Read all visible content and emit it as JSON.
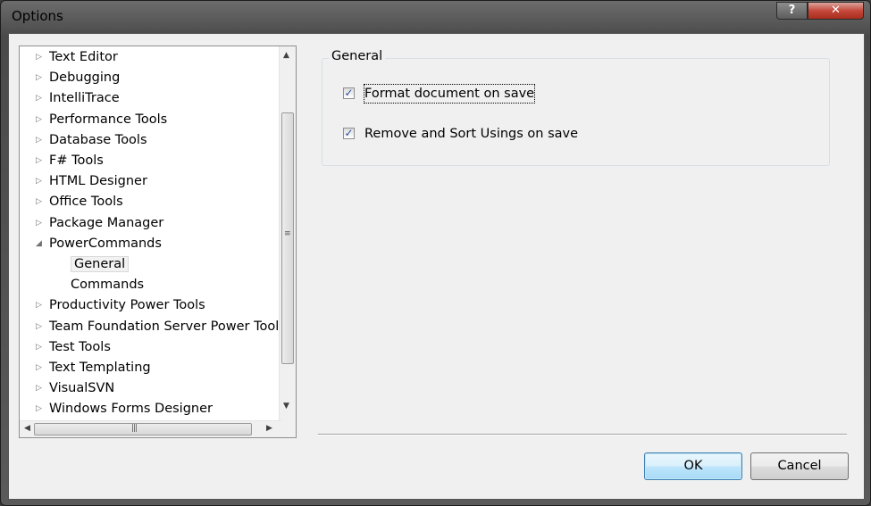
{
  "window": {
    "title": "Options",
    "help_label": "?",
    "close_label": "✕"
  },
  "tree": {
    "items": [
      {
        "label": "Text Editor",
        "level": 0,
        "expander": "collapsed"
      },
      {
        "label": "Debugging",
        "level": 0,
        "expander": "collapsed"
      },
      {
        "label": "IntelliTrace",
        "level": 0,
        "expander": "collapsed"
      },
      {
        "label": "Performance Tools",
        "level": 0,
        "expander": "collapsed"
      },
      {
        "label": "Database Tools",
        "level": 0,
        "expander": "collapsed"
      },
      {
        "label": "F# Tools",
        "level": 0,
        "expander": "collapsed"
      },
      {
        "label": "HTML Designer",
        "level": 0,
        "expander": "collapsed"
      },
      {
        "label": "Office Tools",
        "level": 0,
        "expander": "collapsed"
      },
      {
        "label": "Package Manager",
        "level": 0,
        "expander": "collapsed"
      },
      {
        "label": "PowerCommands",
        "level": 0,
        "expander": "expanded"
      },
      {
        "label": "General",
        "level": 1,
        "expander": "none",
        "selected": true
      },
      {
        "label": "Commands",
        "level": 1,
        "expander": "none"
      },
      {
        "label": "Productivity Power Tools",
        "level": 0,
        "expander": "collapsed"
      },
      {
        "label": "Team Foundation Server Power Tools",
        "level": 0,
        "expander": "collapsed"
      },
      {
        "label": "Test Tools",
        "level": 0,
        "expander": "collapsed"
      },
      {
        "label": "Text Templating",
        "level": 0,
        "expander": "collapsed"
      },
      {
        "label": "VisualSVN",
        "level": 0,
        "expander": "collapsed"
      },
      {
        "label": "Windows Forms Designer",
        "level": 0,
        "expander": "collapsed"
      }
    ]
  },
  "general": {
    "title": "General",
    "format_document": {
      "label": "Format document on save",
      "checked": true
    },
    "remove_sort_usings": {
      "label": "Remove and Sort Usings on save",
      "checked": true
    }
  },
  "buttons": {
    "ok": "OK",
    "cancel": "Cancel"
  },
  "colors": {
    "ok_border": "#3c7fb1",
    "close_button": "#c5483a",
    "checkmark": "#2a4e9a"
  }
}
